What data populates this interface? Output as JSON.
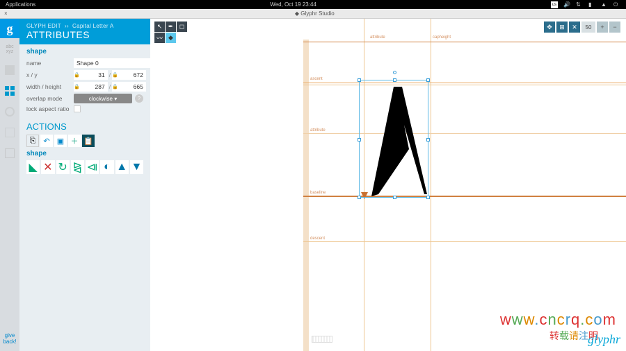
{
  "topbar": {
    "applications": "Applications",
    "datetime": "Wed, Oct 19   23:44",
    "input_indicator": "us"
  },
  "browser": {
    "close": "×",
    "title": "◆ Glyphr Studio"
  },
  "rail": {
    "glyph_logo": "g",
    "abc": "abc\nxyz",
    "give_back": "give\nback!"
  },
  "sidebar": {
    "breadcrumb_context": "GLYPH EDIT",
    "breadcrumb_arrow": "››",
    "breadcrumb_glyph": "Capital Letter A",
    "title": "ATTRIBUTES",
    "shape_section": "shape",
    "name_label": "name",
    "name_value": "Shape 0",
    "xy_label": "x / y",
    "x_value": "31",
    "y_value": "672",
    "wh_label": "width / height",
    "w_value": "287",
    "h_value": "665",
    "overlap_label": "overlap mode",
    "overlap_value": "clockwise ▾",
    "lock_aspect_label": "lock aspect ratio",
    "actions_title": "ACTIONS",
    "shape_actions_label": "shape"
  },
  "canvas": {
    "zoom_value": "50",
    "labels": {
      "ascent": "ascent",
      "capheight": "capheight",
      "attribute": "attribute",
      "baseline": "baseline",
      "descent": "descent"
    }
  },
  "watermark": {
    "line1": "www.cncrq.com",
    "line2": "转载请注明"
  },
  "logo": "glyphr"
}
